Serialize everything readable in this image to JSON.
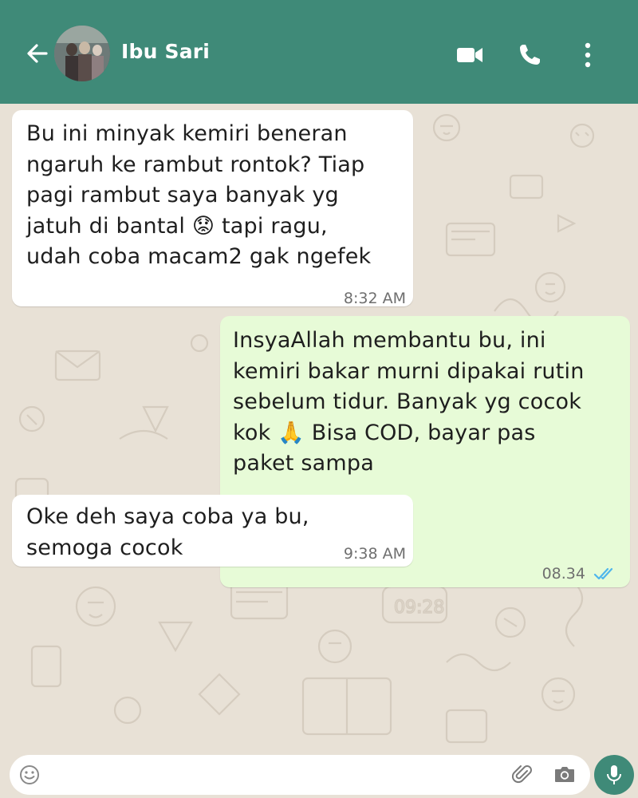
{
  "header": {
    "contact_name": "Ibu Sari",
    "icons": [
      "back-arrow-icon",
      "avatar",
      "video-call-icon",
      "phone-icon",
      "more-vertical-icon"
    ]
  },
  "messages": [
    {
      "direction": "incoming",
      "text": "Bu ini minyak kemiri beneran\nngaruh ke rambut rontok? Tiap\npagi rambut saya banyak yg\njatuh di bantal 😟 tapi ragu,\nudah coba macam2 gak ngefek",
      "time": "8:32 AM"
    },
    {
      "direction": "outgoing",
      "text": "InsyaAllah membantu bu, ini\nkemiri bakar murni dipakai rutin\nsebelum tidur. Banyak yg cocok\nkok 🙏 Bisa COD, bayar pas\npaket sampa",
      "time": "08.34",
      "status": "read"
    },
    {
      "direction": "incoming",
      "text": "Oke deh saya coba ya bu,\nsemoga cocok",
      "time": "9:38 AM"
    }
  ],
  "input": {
    "placeholder": "",
    "value": ""
  },
  "colors": {
    "header": "#3f8a78",
    "wallpaper": "#e8e1d6",
    "incoming_bubble": "#ffffff",
    "outgoing_bubble": "#e7fbd7",
    "read_ticks": "#4fb6ec"
  }
}
